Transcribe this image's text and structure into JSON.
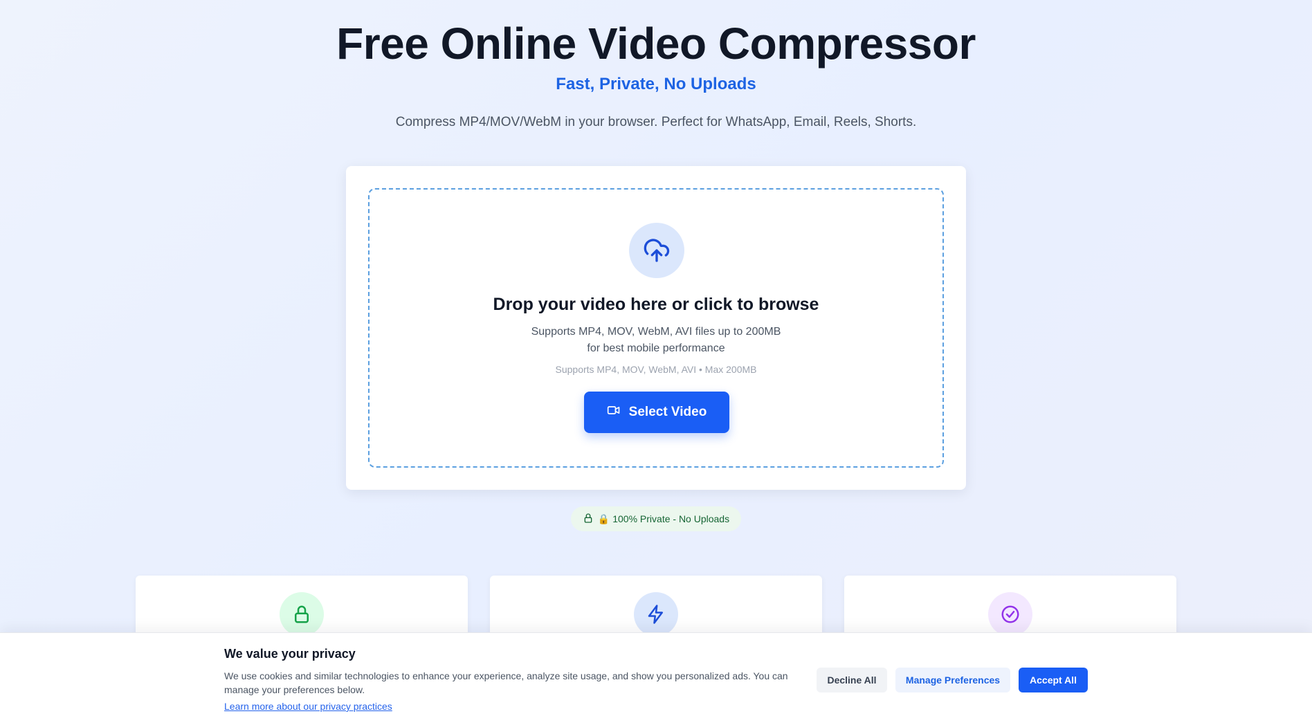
{
  "hero": {
    "title": "Free Online Video Compressor",
    "subtitle": "Fast, Private, No Uploads",
    "description": "Compress MP4/MOV/WebM in your browser. Perfect for WhatsApp, Email, Reels, Shorts."
  },
  "upload": {
    "icon": "cloud-upload-icon",
    "title": "Drop your video here or click to browse",
    "subtitle_line1": "Supports MP4, MOV, WebM, AVI files up to 200MB",
    "subtitle_line2": "for best mobile performance",
    "note": "Supports MP4, MOV, WebM, AVI • Max 200MB",
    "button_label": "Select Video",
    "button_icon": "video-camera-icon"
  },
  "privacy_badge": {
    "icon": "lock-icon",
    "text": "🔒 100% Private - No Uploads"
  },
  "features": [
    {
      "icon": "lock-icon",
      "color": "#16a34a",
      "bg": "#dcfce7"
    },
    {
      "icon": "lightning-icon",
      "color": "#1d4ed8",
      "bg": "#dbe7fc"
    },
    {
      "icon": "check-circle-icon",
      "color": "#9333ea",
      "bg": "#f3e8ff"
    }
  ],
  "cookie": {
    "title": "We value your privacy",
    "text": "We use cookies and similar technologies to enhance your experience, analyze site usage, and show you personalized ads. You can manage your preferences below.",
    "link": "Learn more about our privacy practices",
    "decline_label": "Decline All",
    "manage_label": "Manage Preferences",
    "accept_label": "Accept All"
  },
  "colors": {
    "primary": "#1a5ef5",
    "accent_text": "#1d63e3",
    "dropzone_border": "#5b9fe0",
    "privacy_green": "#166534"
  }
}
